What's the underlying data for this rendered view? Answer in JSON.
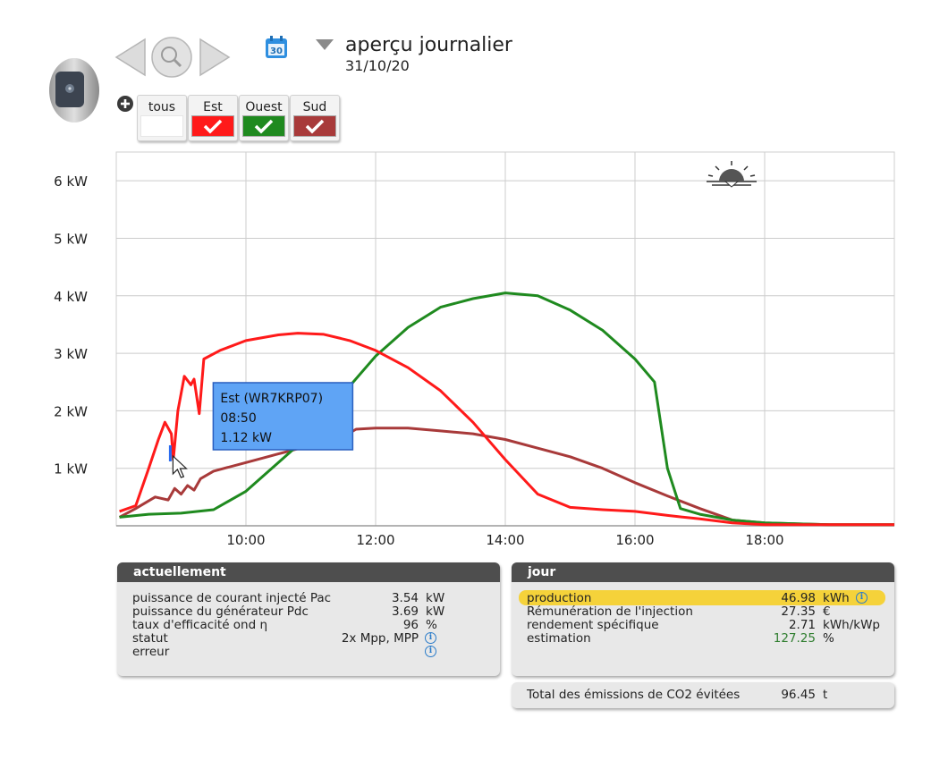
{
  "header": {
    "view_title": "aperçu journalier",
    "date": "31/10/20",
    "calendar_day": "30"
  },
  "filters": [
    {
      "label": "tous",
      "color": "#ffffff",
      "checked": false
    },
    {
      "label": "Est",
      "color": "#ff1a1a",
      "checked": true
    },
    {
      "label": "Ouest",
      "color": "#1f8a1f",
      "checked": true
    },
    {
      "label": "Sud",
      "color": "#a83a3a",
      "checked": true
    }
  ],
  "chart_data": {
    "type": "line",
    "y_ticks": [
      "1 kW",
      "2 kW",
      "3 kW",
      "4 kW",
      "5 kW",
      "6 kW"
    ],
    "x_ticks": [
      "10:00",
      "12:00",
      "14:00",
      "16:00",
      "18:00"
    ],
    "x_unit": "hours",
    "xlim": [
      8.0,
      20.0
    ],
    "ylim": [
      0.0,
      6.5
    ],
    "grid": true,
    "series": [
      {
        "name": "Est",
        "color": "#ff1a1a",
        "points": [
          [
            8.05,
            0.25
          ],
          [
            8.3,
            0.35
          ],
          [
            8.5,
            1.0
          ],
          [
            8.65,
            1.5
          ],
          [
            8.75,
            1.8
          ],
          [
            8.85,
            1.6
          ],
          [
            8.88,
            1.15
          ],
          [
            8.95,
            2.0
          ],
          [
            9.05,
            2.6
          ],
          [
            9.15,
            2.45
          ],
          [
            9.2,
            2.55
          ],
          [
            9.28,
            1.95
          ],
          [
            9.35,
            2.9
          ],
          [
            9.6,
            3.05
          ],
          [
            10.0,
            3.22
          ],
          [
            10.5,
            3.32
          ],
          [
            10.8,
            3.35
          ],
          [
            11.2,
            3.33
          ],
          [
            11.6,
            3.22
          ],
          [
            12.0,
            3.05
          ],
          [
            12.5,
            2.75
          ],
          [
            13.0,
            2.35
          ],
          [
            13.5,
            1.8
          ],
          [
            14.0,
            1.15
          ],
          [
            14.5,
            0.55
          ],
          [
            15.0,
            0.32
          ],
          [
            15.5,
            0.28
          ],
          [
            16.0,
            0.25
          ],
          [
            16.5,
            0.18
          ],
          [
            17.0,
            0.12
          ],
          [
            17.5,
            0.05
          ],
          [
            18.0,
            0.02
          ],
          [
            19.0,
            0.02
          ],
          [
            20.0,
            0.02
          ]
        ]
      },
      {
        "name": "Ouest",
        "color": "#1f8a1f",
        "points": [
          [
            8.05,
            0.15
          ],
          [
            8.5,
            0.2
          ],
          [
            9.0,
            0.22
          ],
          [
            9.5,
            0.28
          ],
          [
            10.0,
            0.6
          ],
          [
            10.5,
            1.1
          ],
          [
            11.0,
            1.6
          ],
          [
            11.5,
            2.3
          ],
          [
            12.0,
            2.95
          ],
          [
            12.5,
            3.45
          ],
          [
            13.0,
            3.8
          ],
          [
            13.5,
            3.95
          ],
          [
            14.0,
            4.05
          ],
          [
            14.5,
            4.0
          ],
          [
            15.0,
            3.75
          ],
          [
            15.5,
            3.4
          ],
          [
            15.8,
            3.1
          ],
          [
            16.0,
            2.9
          ],
          [
            16.3,
            2.5
          ],
          [
            16.5,
            1.0
          ],
          [
            16.7,
            0.3
          ],
          [
            17.0,
            0.2
          ],
          [
            17.5,
            0.1
          ],
          [
            18.0,
            0.05
          ],
          [
            19.0,
            0.02
          ],
          [
            20.0,
            0.02
          ]
        ]
      },
      {
        "name": "Sud",
        "color": "#a83a3a",
        "points": [
          [
            8.05,
            0.15
          ],
          [
            8.3,
            0.3
          ],
          [
            8.6,
            0.5
          ],
          [
            8.8,
            0.45
          ],
          [
            8.9,
            0.65
          ],
          [
            9.0,
            0.55
          ],
          [
            9.1,
            0.7
          ],
          [
            9.2,
            0.62
          ],
          [
            9.3,
            0.82
          ],
          [
            9.5,
            0.95
          ],
          [
            10.0,
            1.1
          ],
          [
            10.5,
            1.25
          ],
          [
            11.0,
            1.4
          ],
          [
            11.5,
            1.55
          ],
          [
            11.7,
            1.68
          ],
          [
            12.0,
            1.7
          ],
          [
            12.5,
            1.7
          ],
          [
            13.0,
            1.65
          ],
          [
            13.5,
            1.6
          ],
          [
            14.0,
            1.5
          ],
          [
            14.5,
            1.35
          ],
          [
            15.0,
            1.2
          ],
          [
            15.5,
            1.0
          ],
          [
            16.0,
            0.75
          ],
          [
            16.5,
            0.52
          ],
          [
            17.0,
            0.3
          ],
          [
            17.5,
            0.1
          ],
          [
            18.0,
            0.05
          ],
          [
            19.0,
            0.02
          ],
          [
            20.0,
            0.02
          ]
        ]
      }
    ],
    "tooltip": {
      "line1": "Est (WR7KRP07)",
      "line2": "08:50",
      "line3": "1.12 kW",
      "time": 8.833,
      "value": 1.12
    }
  },
  "actuellement": {
    "title": "actuellement",
    "rows": [
      {
        "label": "puissance de courant injecté Pac",
        "value": "3.54",
        "unit": "kW"
      },
      {
        "label": "puissance du générateur Pdc",
        "value": "3.69",
        "unit": "kW"
      },
      {
        "label": "taux d'efficacité ond η",
        "value": "96",
        "unit": "%"
      },
      {
        "label": "statut",
        "value": "2x Mpp, MPP",
        "unit": ""
      },
      {
        "label": "erreur",
        "value": "",
        "unit": ""
      }
    ]
  },
  "jour": {
    "title": "jour",
    "rows": [
      {
        "label": "production",
        "value": "46.98",
        "unit": "kWh"
      },
      {
        "label": "Rémunération de l'injection",
        "value": "27.35",
        "unit": "€"
      },
      {
        "label": "rendement spécifique",
        "value": "2.71",
        "unit": "kWh/kWp"
      },
      {
        "label": "estimation",
        "value": "127.25",
        "unit": "%"
      }
    ],
    "highlight_color": "#f5d23a",
    "estimation_color": "#2e7d2e"
  },
  "co2": {
    "label": "Total des émissions de CO2 évitées",
    "value": "96.45",
    "unit": "t"
  }
}
